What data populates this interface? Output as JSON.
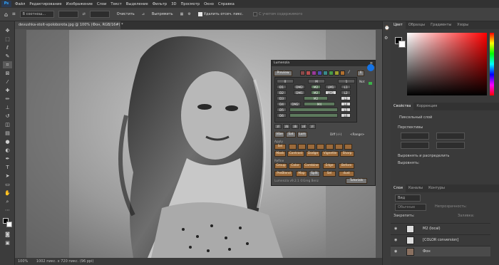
{
  "menubar": {
    "logo": "Ps",
    "items": [
      "Файл",
      "Редактирование",
      "Изображение",
      "Слои",
      "Текст",
      "Выделение",
      "Фильтр",
      "3D",
      "Просмотр",
      "Окно",
      "Справка"
    ]
  },
  "options": {
    "crop_ratio": "В соотнош...",
    "clear": "Очистить",
    "straighten": "Выпрямить",
    "delete_pixels": "Удалить отсеч. пикс.",
    "content_aware": "С учетом содержимого"
  },
  "document": {
    "tab": "devushka-stoit-vpoloborota.jpg @ 100% (Фон, RGB/16#) *",
    "zoom": "100%",
    "size": "1002 пикс. x 720 пикс. (96 ppi)"
  },
  "luminosity": {
    "title": "Lumenzia",
    "preview": "Preview",
    "x_label": "X",
    "not_label": "Not",
    "zones_top": [
      "0",
      "M",
      "1"
    ],
    "rows": [
      [
        "D1",
        "DM2",
        "M2",
        "LM1",
        "L1"
      ],
      [
        "D2",
        "DM1",
        "M2",
        "LM1",
        "L2"
      ],
      [
        "D3",
        "M2",
        "L3"
      ],
      [
        "D4",
        "DM2",
        "M4",
        "L4"
      ],
      [
        "D5",
        "L5"
      ],
      [
        "D6",
        "L6"
      ]
    ],
    "bottom_row": [
      "zl",
      "zb",
      "zb",
      "zd",
      "zl"
    ],
    "controls": {
      "vibe": "Vibe",
      "sat": "Sat",
      "lum": "Lum",
      "diff": "Diff (-/-)",
      "range": "<Range>"
    },
    "apply_label": "Apply",
    "apply_buttons": [
      "Sel",
      "Mask",
      "Contrast",
      "Dodge",
      "Vignette",
      "Sharp"
    ],
    "refine_label": "Refine",
    "refine_buttons": [
      "Group",
      "Color",
      "Combine",
      "Edge",
      "Before"
    ],
    "bottom_buttons": [
      "PreBlend",
      "Map",
      "Split",
      "Sel",
      "dust"
    ],
    "footer": "Lumenzia v9.2.1 ©Greg Benz",
    "tutorials": "Tutorials",
    "swatches": [
      "#8a4a4a",
      "#b85050",
      "#9a3a9a",
      "#5050b0",
      "#3a8a8a",
      "#4a9a4a",
      "#a0a030",
      "#b07030"
    ]
  },
  "panels": {
    "color_tabs": [
      "Цвет",
      "Образцы",
      "Градиенты",
      "Узоры"
    ],
    "props_tabs": [
      "Свойства",
      "Коррекция"
    ],
    "pixel_layer": "Пиксельный слой",
    "transform": "Перспективы",
    "align": "Выровнять и распределить",
    "align_sub": "Выровнять:",
    "layers_tabs": [
      "Слои",
      "Каналы",
      "Контуры"
    ],
    "kind": "Вид",
    "blend": "Обычные",
    "opacity_label": "Непрозрачность:",
    "fill_label": "Заливка:",
    "lock_label": "Закрепить:",
    "layers": [
      {
        "name": "M2 (local)"
      },
      {
        "name": "[COLOR conversion]"
      },
      {
        "name": "Фон"
      }
    ]
  }
}
